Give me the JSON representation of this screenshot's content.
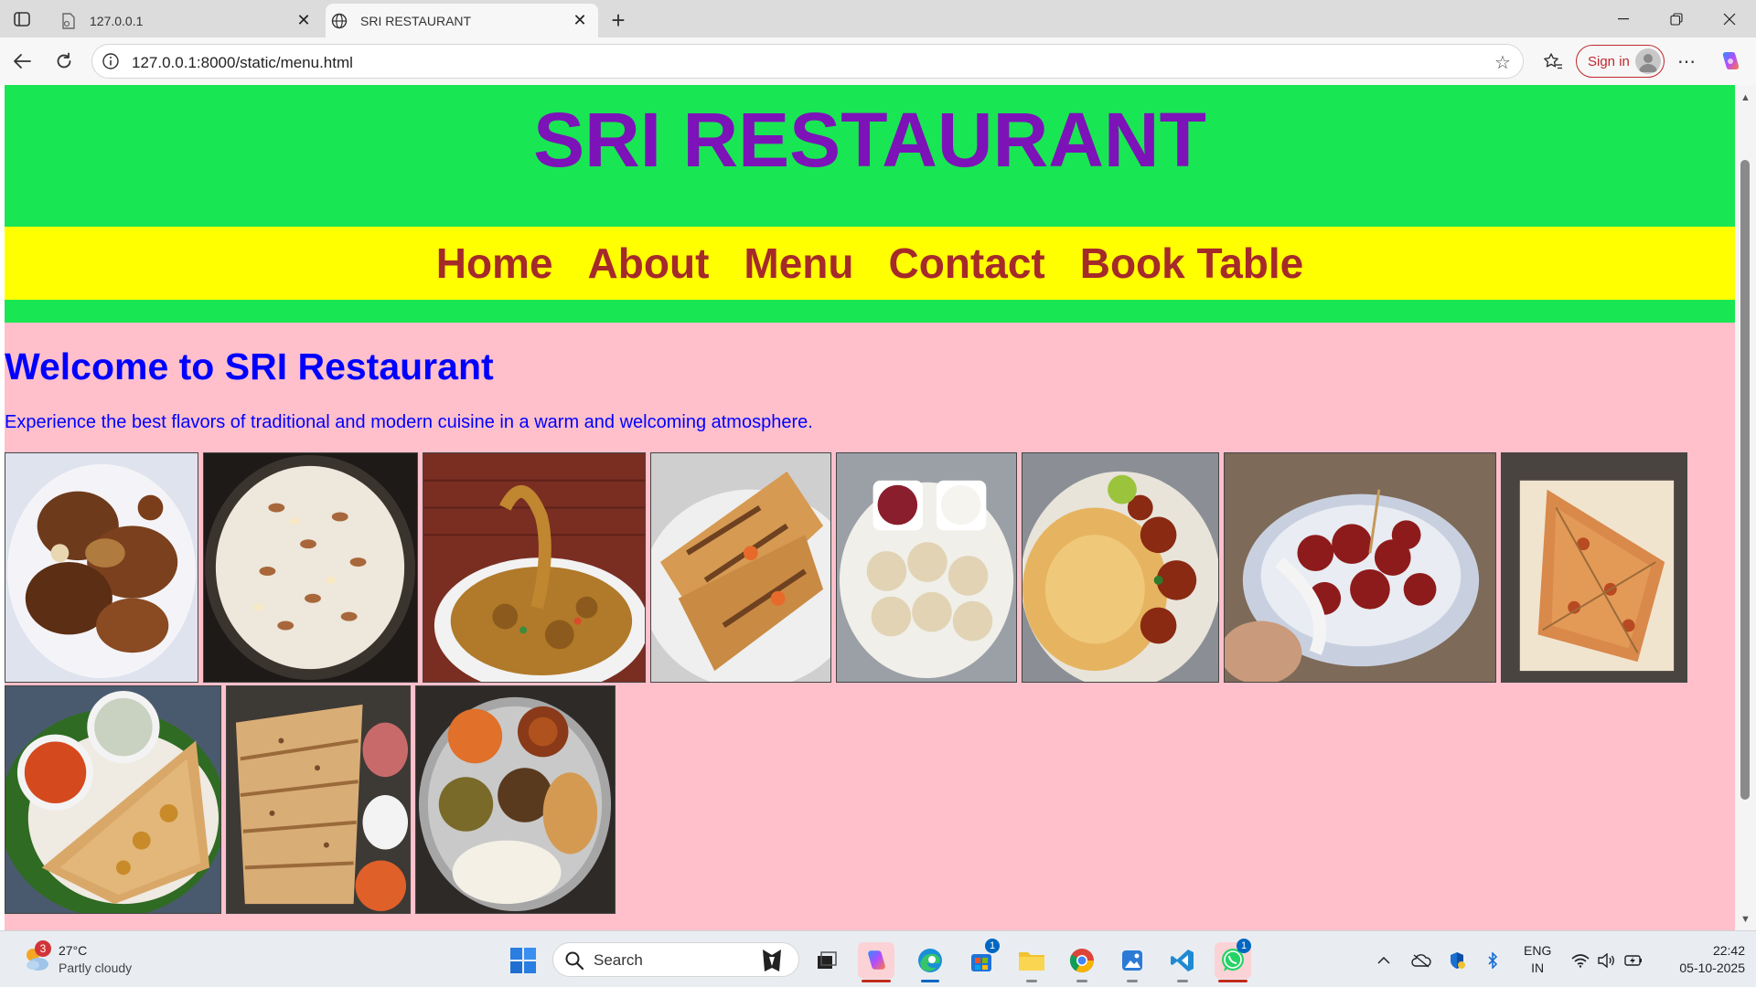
{
  "browser": {
    "tabs": [
      {
        "title": "127.0.0.1",
        "active": false
      },
      {
        "title": "SRI RESTAURANT",
        "active": true
      }
    ],
    "url": "127.0.0.1:8000/static/menu.html",
    "signin_label": "Sign in"
  },
  "site": {
    "title": "SRI RESTAURANT",
    "nav": [
      "Home",
      "About",
      "Menu",
      "Contact",
      "Book Table"
    ],
    "welcome_heading": "Welcome to SRI Restaurant",
    "intro": "Experience the best flavors of traditional and modern cuisine in a warm and welcoming atmosphere.",
    "photos": [
      "fried-chicken-photo",
      "semiya-payasam-photo",
      "noodles-photo",
      "grilled-sandwich-photo",
      "momos-photo",
      "parotta-chilli-chicken-photo",
      "gobi-manchurian-photo",
      "pizza-photo",
      "masala-dosa-photo",
      "garlic-bread-photo",
      "thali-photo"
    ]
  },
  "taskbar": {
    "weather_badge": "3",
    "temperature": "27°C",
    "condition": "Partly cloudy",
    "search_placeholder": "Search",
    "store_badge": "1",
    "whatsapp_badge": "1",
    "language_line1": "ENG",
    "language_line2": "IN",
    "time": "22:42",
    "date": "05-10-2025"
  },
  "colors": {
    "header_green": "#19e653",
    "title_purple": "#7d12b8",
    "nav_yellow": "#ffff00",
    "nav_text": "#a52a2a",
    "page_pink": "#ffc0cb",
    "text_blue": "#0000ff"
  }
}
